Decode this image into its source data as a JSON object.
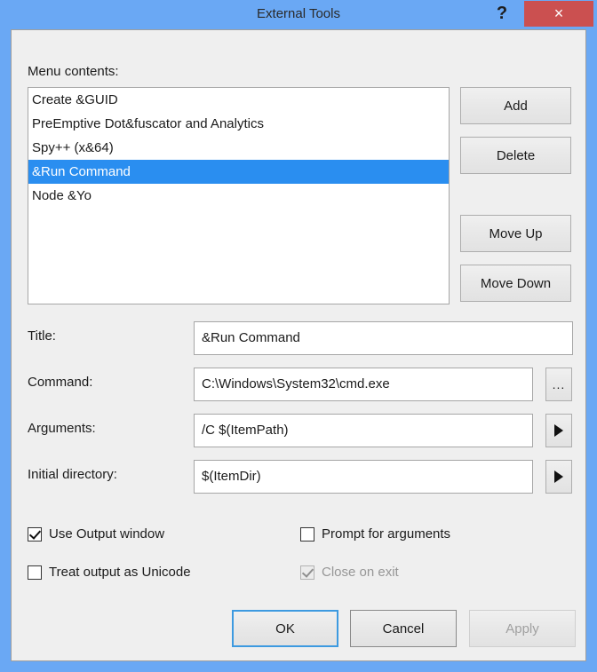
{
  "window": {
    "title": "External Tools",
    "help_icon": "?",
    "close_icon": "×",
    "accent_color": "#6aa8f4",
    "close_color": "#cb5050",
    "selection_color": "#2a8ef0"
  },
  "menu_contents": {
    "label": "Menu contents:",
    "items": [
      {
        "text": "Create &GUID",
        "selected": false
      },
      {
        "text": "PreEmptive Dot&fuscator and Analytics",
        "selected": false
      },
      {
        "text": "Spy++ (x&64)",
        "selected": false
      },
      {
        "text": "&Run Command",
        "selected": true
      },
      {
        "text": "Node &Yo",
        "selected": false
      }
    ]
  },
  "side_buttons": {
    "add": "Add",
    "delete": "Delete",
    "move_up": "Move Up",
    "move_down": "Move Down"
  },
  "fields": {
    "title": {
      "label": "Title:",
      "value": "&Run Command"
    },
    "command": {
      "label": "Command:",
      "value": "C:\\Windows\\System32\\cmd.exe",
      "button": "..."
    },
    "arguments": {
      "label": "Arguments:",
      "value": "/C $(ItemPath)",
      "button": "▶"
    },
    "initial_directory": {
      "label": "Initial directory:",
      "value": "$(ItemDir)",
      "button": "▶"
    }
  },
  "checkboxes": {
    "use_output_window": {
      "label": "Use Output window",
      "checked": true,
      "enabled": true
    },
    "prompt_for_arguments": {
      "label": "Prompt for arguments",
      "checked": false,
      "enabled": true
    },
    "treat_output_as_unicode": {
      "label": "Treat output as Unicode",
      "checked": false,
      "enabled": true
    },
    "close_on_exit": {
      "label": "Close on exit",
      "checked": true,
      "enabled": false
    }
  },
  "dialog_buttons": {
    "ok": {
      "label": "OK",
      "enabled": true,
      "default": true
    },
    "cancel": {
      "label": "Cancel",
      "enabled": true,
      "default": false
    },
    "apply": {
      "label": "Apply",
      "enabled": false,
      "default": false
    }
  }
}
